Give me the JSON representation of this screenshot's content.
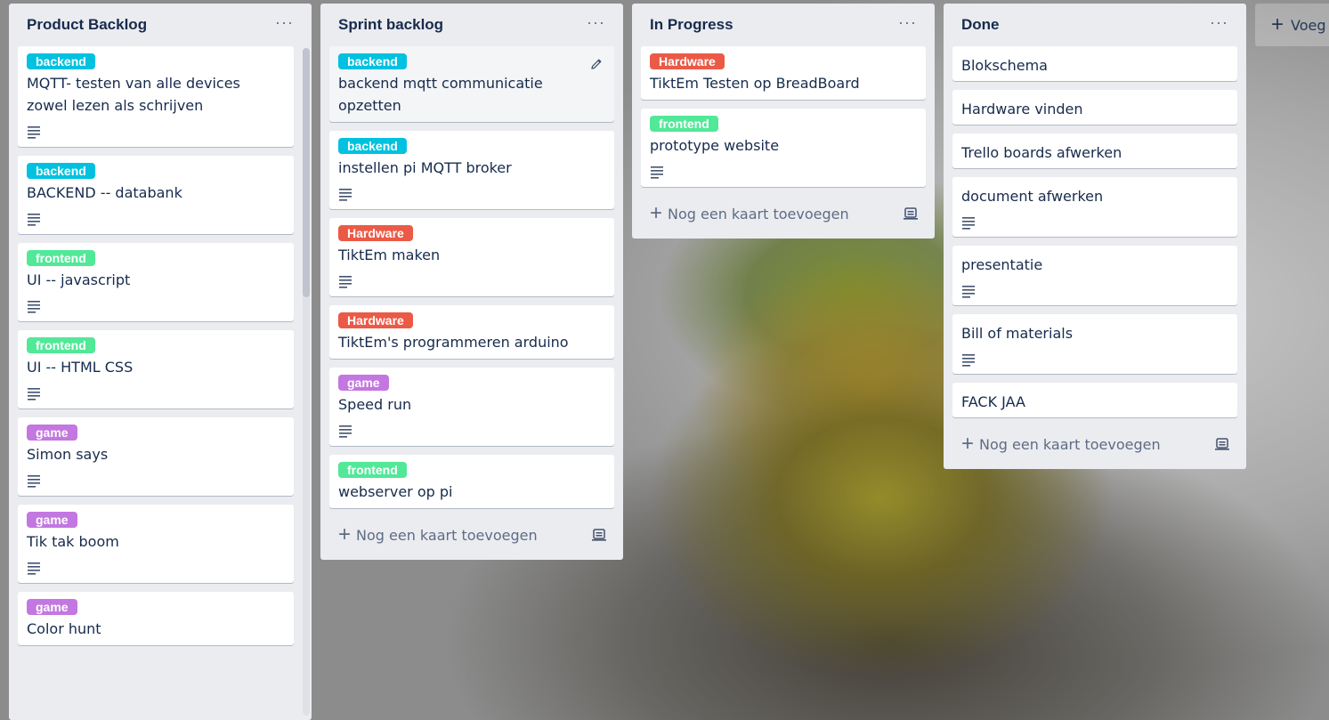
{
  "lists": [
    {
      "title": "Product Backlog",
      "menu": "···",
      "cards": [
        {
          "label": "backend",
          "title": "MQTT- testen van alle devices zowel lezen als schrijven"
        },
        {
          "label": "backend",
          "title": "BACKEND -- databank"
        },
        {
          "label": "frontend",
          "title": "UI -- javascript"
        },
        {
          "label": "frontend",
          "title": "UI -- HTML CSS"
        },
        {
          "label": "game",
          "title": "Simon says"
        },
        {
          "label": "game",
          "title": "Tik tak boom"
        },
        {
          "label": "game",
          "title": "Color hunt"
        }
      ]
    },
    {
      "title": "Sprint backlog",
      "menu": "···",
      "cards": [
        {
          "label": "backend",
          "title": "backend mqtt communicatie opzetten"
        },
        {
          "label": "backend",
          "title": "instellen pi MQTT broker"
        },
        {
          "label": "Hardware",
          "title": "TiktEm maken"
        },
        {
          "label": "Hardware",
          "title": "TiktEm's programmeren arduino"
        },
        {
          "label": "game",
          "title": "Speed run"
        },
        {
          "label": "frontend",
          "title": "webserver op pi"
        }
      ],
      "add_card": "Nog een kaart toevoegen"
    },
    {
      "title": "In Progress",
      "menu": "···",
      "cards": [
        {
          "label": "Hardware",
          "title": "TiktEm Testen op BreadBoard"
        },
        {
          "label": "frontend",
          "title": "prototype website"
        }
      ],
      "add_card": "Nog een kaart toevoegen"
    },
    {
      "title": "Done",
      "menu": "···",
      "cards": [
        {
          "title": "Blokschema"
        },
        {
          "title": "Hardware vinden"
        },
        {
          "title": "Trello boards afwerken"
        },
        {
          "title": "document afwerken"
        },
        {
          "title": "presentatie"
        },
        {
          "title": "Bill of materials"
        },
        {
          "title": "FACK JAA"
        }
      ],
      "add_card": "Nog een kaart toevoegen"
    }
  ],
  "add_list": {
    "plus": "+",
    "label": "Voeg"
  },
  "colors": {
    "backend": "#00c2e0",
    "frontend": "#51e898",
    "hardware": "#eb5a46",
    "game": "#c377e0",
    "list_bg": "#ebecf0"
  }
}
